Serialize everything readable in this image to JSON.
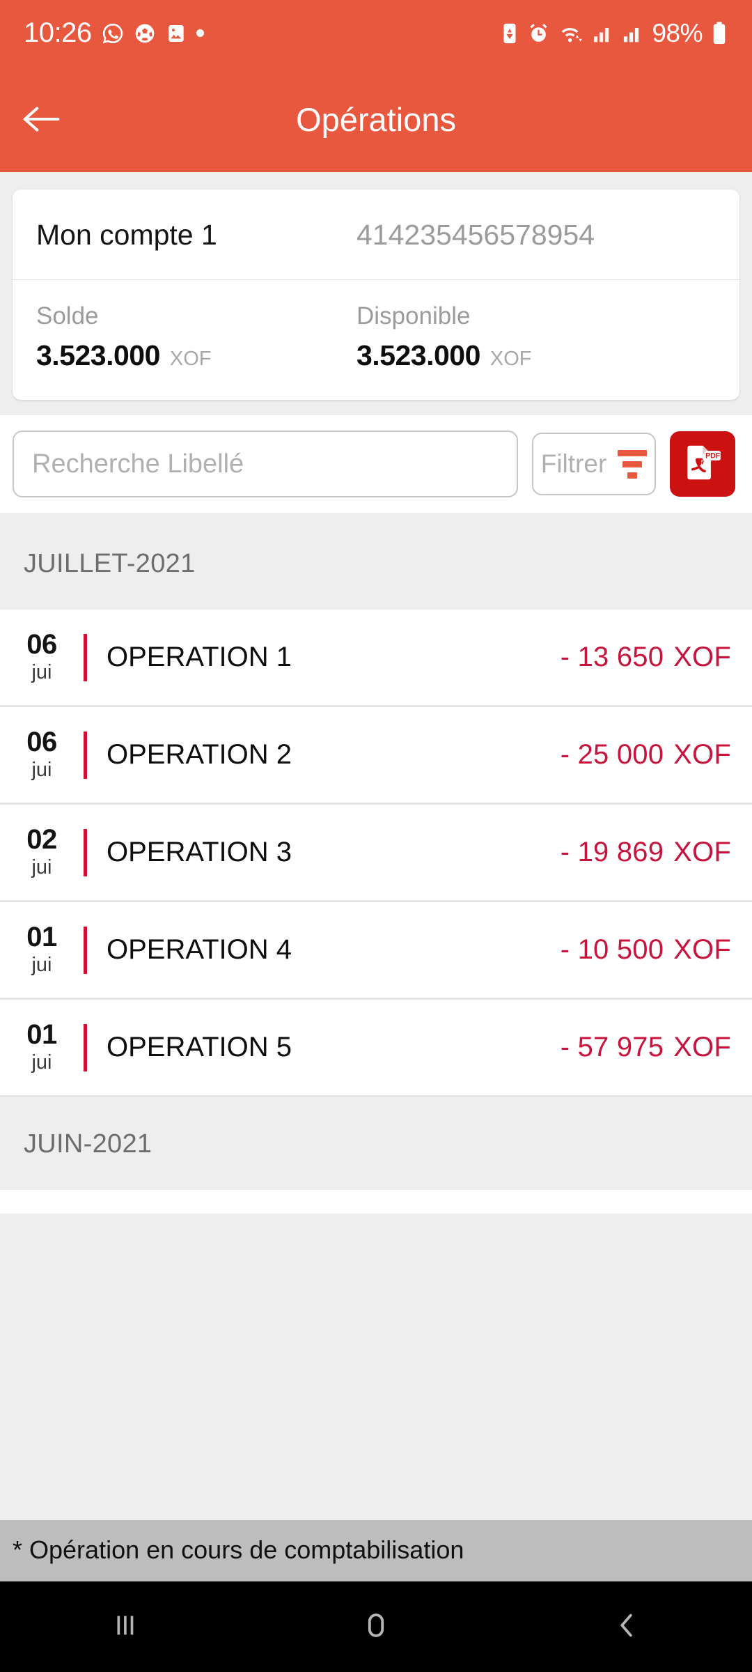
{
  "statusbar": {
    "time": "10:26",
    "battery_percent": "98%",
    "left_icons": [
      "whatsapp-icon",
      "football-icon",
      "photos-icon",
      "dot-icon"
    ],
    "right_icons": [
      "data-saver-icon",
      "alarm-icon",
      "wifi-icon",
      "signal-1-icon",
      "signal-2-icon"
    ],
    "accent": "#e8583f"
  },
  "appbar": {
    "title": "Opérations",
    "back_label": "back-arrow",
    "background": "#e8583f"
  },
  "account": {
    "name": "Mon compte 1",
    "number": "414235456578954",
    "balance": {
      "label": "Solde",
      "amount": "3.523.000",
      "currency": "XOF"
    },
    "available": {
      "label": "Disponible",
      "amount": "3.523.000",
      "currency": "XOF"
    }
  },
  "tools": {
    "search_placeholder": "Recherche Libellé",
    "search_value": "",
    "filter_label": "Filtrer",
    "pdf_label": "PDF",
    "pdf_color": "#cc1111"
  },
  "sections": [
    {
      "header": "JUILLET-2021",
      "transactions": [
        {
          "day": "06",
          "month": "jui",
          "label": "OPERATION 1",
          "amount": "- 13 650",
          "currency": "XOF"
        },
        {
          "day": "06",
          "month": "jui",
          "label": "OPERATION 2",
          "amount": "- 25 000",
          "currency": "XOF"
        },
        {
          "day": "02",
          "month": "jui",
          "label": "OPERATION 3",
          "amount": "- 19 869",
          "currency": "XOF"
        },
        {
          "day": "01",
          "month": "jui",
          "label": "OPERATION 4",
          "amount": "- 10 500",
          "currency": "XOF"
        },
        {
          "day": "01",
          "month": "jui",
          "label": "OPERATION 5",
          "amount": "- 57 975",
          "currency": "XOF"
        }
      ]
    },
    {
      "header": "JUIN-2021",
      "transactions": []
    }
  ],
  "footnote": "* Opération en cours de comptabilisation",
  "navbar": {
    "recents": "recents-icon",
    "home": "home-icon",
    "back": "back-icon"
  },
  "colors": {
    "amount_red": "#c8143c",
    "row_bar_red": "#cc1133",
    "page_bg": "#eeeeee",
    "footnote_bg": "#bdbdbd"
  }
}
